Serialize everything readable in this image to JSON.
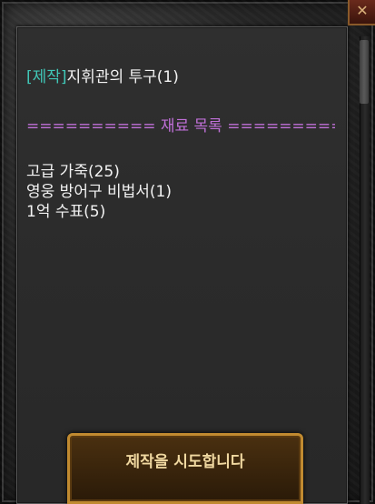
{
  "window": {
    "close_symbol": "✕"
  },
  "recipe": {
    "tag": "[제작]",
    "item_name": "지휘관의 투구(1)"
  },
  "materials_header": "========== 재료 목록 ==========",
  "materials": [
    "고급 가죽(25)",
    "영웅 방어구 비법서(1)",
    "1억 수표(5)"
  ],
  "craft_button": {
    "label": "제작을 시도합니다"
  },
  "colors": {
    "tag": "#40c8b8",
    "divider": "#c070d8",
    "text": "#f2f2f2",
    "button_border": "#c08a30"
  }
}
